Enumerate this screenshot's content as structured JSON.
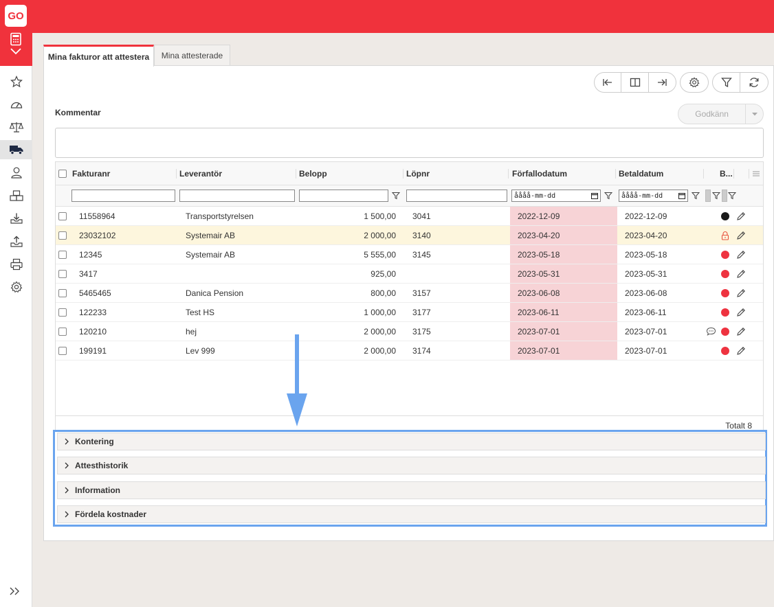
{
  "app": {
    "logo": "GO"
  },
  "tabs": [
    {
      "label": "Mina fakturor att attestera",
      "active": true
    },
    {
      "label": "Mina attesterade",
      "active": false
    }
  ],
  "comment": {
    "label": "Kommentar",
    "value": ""
  },
  "approve": {
    "label": "Godkänn"
  },
  "grid": {
    "columns": [
      "Fakturanr",
      "Leverantör",
      "Belopp",
      "Löpnr",
      "Förfallodatum",
      "Betaldatum",
      "B..."
    ],
    "date_placeholder": "åååå-mm-dd",
    "rows": [
      {
        "invoice": "11558964",
        "supplier": "Transportstyrelsen",
        "amount": "1 500,00",
        "serial": "3041",
        "due": "2022-12-09",
        "paid": "2022-12-09",
        "status": "black-dot",
        "highlight": false,
        "comment": false
      },
      {
        "invoice": "23032102",
        "supplier": "Systemair AB",
        "amount": "2 000,00",
        "serial": "3140",
        "due": "2023-04-20",
        "paid": "2023-04-20",
        "status": "lock",
        "highlight": true,
        "comment": false
      },
      {
        "invoice": "12345",
        "supplier": "Systemair AB",
        "amount": "5 555,00",
        "serial": "3145",
        "due": "2023-05-18",
        "paid": "2023-05-18",
        "status": "red-dot",
        "highlight": false,
        "comment": false
      },
      {
        "invoice": "3417",
        "supplier": "",
        "amount": "925,00",
        "serial": "",
        "due": "2023-05-31",
        "paid": "2023-05-31",
        "status": "red-dot",
        "highlight": false,
        "comment": false
      },
      {
        "invoice": "5465465",
        "supplier": "Danica Pension",
        "amount": "800,00",
        "serial": "3157",
        "due": "2023-06-08",
        "paid": "2023-06-08",
        "status": "red-dot",
        "highlight": false,
        "comment": false
      },
      {
        "invoice": "122233",
        "supplier": "Test HS",
        "amount": "1 000,00",
        "serial": "3177",
        "due": "2023-06-11",
        "paid": "2023-06-11",
        "status": "red-dot",
        "highlight": false,
        "comment": false
      },
      {
        "invoice": "120210",
        "supplier": "hej",
        "amount": "2 000,00",
        "serial": "3175",
        "due": "2023-07-01",
        "paid": "2023-07-01",
        "status": "red-dot",
        "highlight": false,
        "comment": true
      },
      {
        "invoice": "199191",
        "supplier": "Lev 999",
        "amount": "2 000,00",
        "serial": "3174",
        "due": "2023-07-01",
        "paid": "2023-07-01",
        "status": "red-dot",
        "highlight": false,
        "comment": false
      }
    ],
    "total": "Totalt 8"
  },
  "sections": [
    "Kontering",
    "Attesthistorik",
    "Information",
    "Fördela kostnader"
  ],
  "colors": {
    "brand": "#f0323c",
    "due_bg": "#f7d3d6",
    "highlight_row": "#fdf6dd",
    "callout": "#6aa4ee",
    "status_red": "#ee3340",
    "status_black": "#1a1a1a"
  }
}
